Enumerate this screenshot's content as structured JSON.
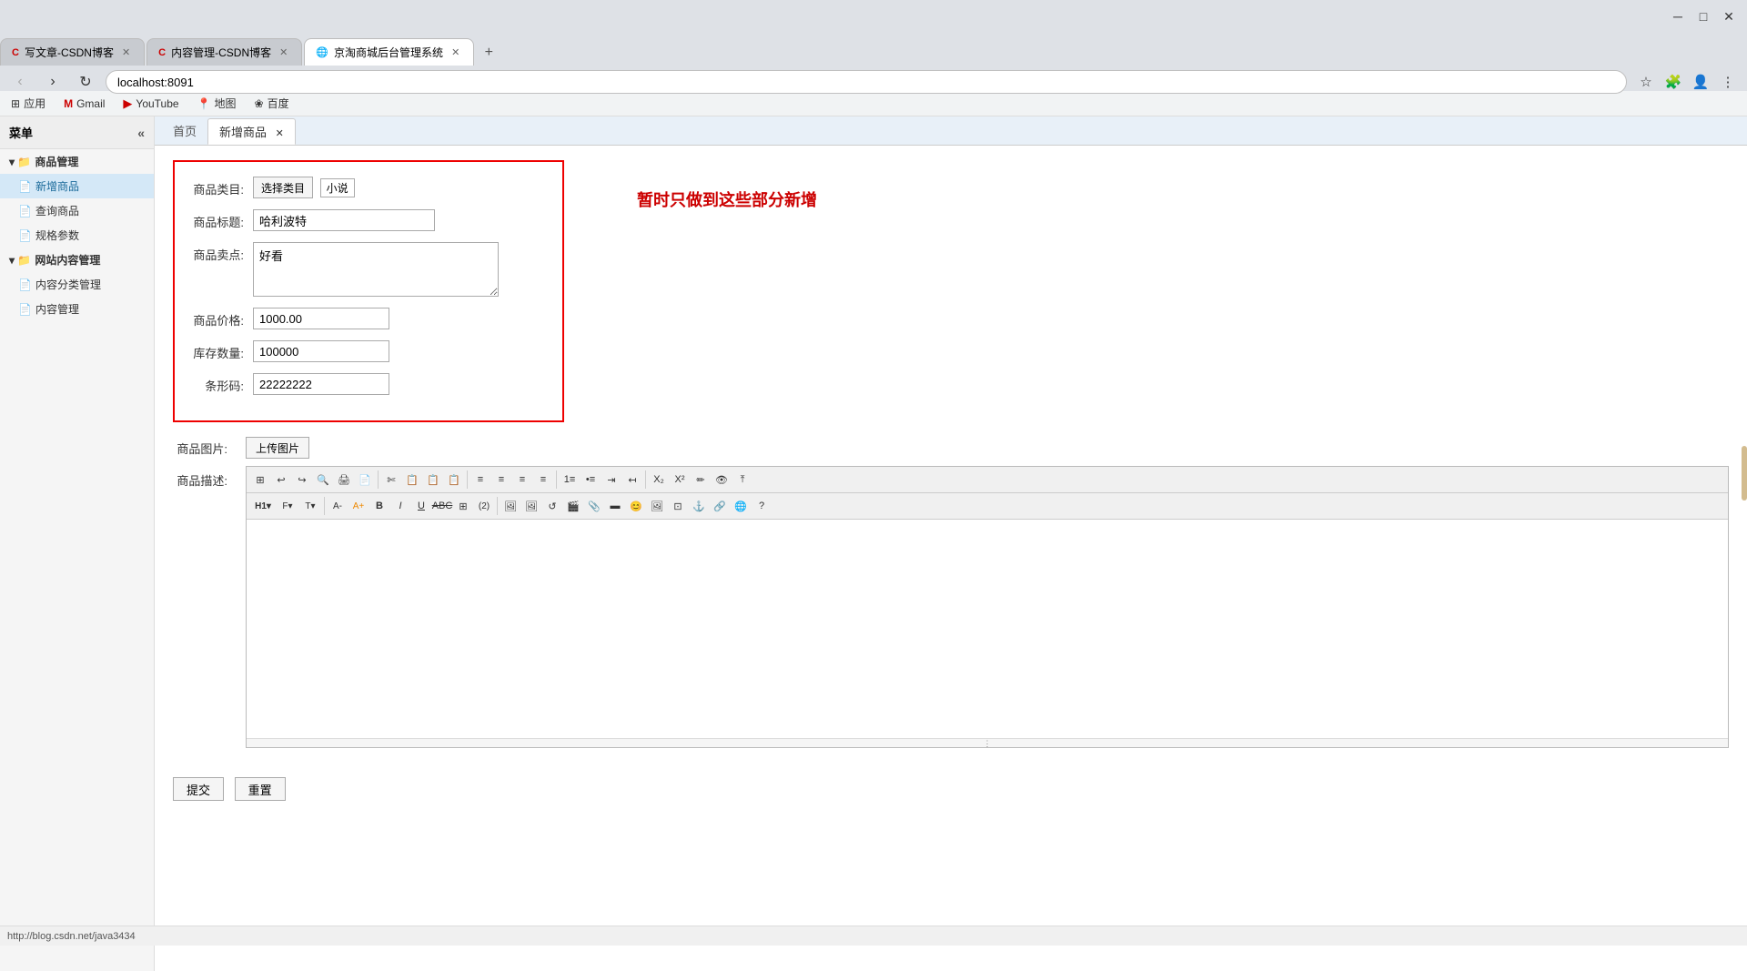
{
  "browser": {
    "tabs": [
      {
        "id": "tab1",
        "title": "写文章-CSDN博客",
        "active": false,
        "favicon": "C"
      },
      {
        "id": "tab2",
        "title": "内容管理-CSDN博客",
        "active": false,
        "favicon": "C"
      },
      {
        "id": "tab3",
        "title": "京淘商城后台管理系统",
        "active": true,
        "favicon": "🌐"
      }
    ],
    "address": "localhost:8091",
    "bookmarks": [
      {
        "label": "应用",
        "icon": "⊞"
      },
      {
        "label": "Gmail",
        "icon": "M"
      },
      {
        "label": "YouTube",
        "icon": "▶"
      },
      {
        "label": "地图",
        "icon": "📍"
      },
      {
        "label": "百度",
        "icon": "❀"
      }
    ]
  },
  "sidebar": {
    "title": "菜单",
    "categories": [
      {
        "label": "商品管理",
        "icon": "▾",
        "children": [
          {
            "label": "新增商品",
            "selected": true
          },
          {
            "label": "查询商品",
            "selected": false
          },
          {
            "label": "规格参数",
            "selected": false
          }
        ]
      },
      {
        "label": "网站内容管理",
        "icon": "▾",
        "children": [
          {
            "label": "内容分类管理",
            "selected": false
          },
          {
            "label": "内容管理",
            "selected": false
          }
        ]
      }
    ]
  },
  "page_tabs": [
    {
      "label": "首页",
      "active": false
    },
    {
      "label": "新增商品",
      "active": true,
      "closeable": true
    }
  ],
  "form": {
    "category_label": "商品类目:",
    "category_btn": "选择类目",
    "category_tag": "小说",
    "title_label": "商品标题:",
    "title_value": "哈利波特",
    "selling_label": "商品卖点:",
    "selling_value": "好看",
    "price_label": "商品价格:",
    "price_value": "1000.00",
    "stock_label": "库存数量:",
    "stock_value": "100000",
    "barcode_label": "条形码:",
    "barcode_value": "22222222",
    "image_label": "商品图片:",
    "image_btn": "上传图片",
    "desc_label": "商品描述:"
  },
  "notice_text": "暂时只做到这些部分新增",
  "editor": {
    "toolbar_row1": [
      "⊞",
      "↩",
      "↪",
      "🔍",
      "🖨",
      "📄",
      "✄",
      "📋",
      "📋",
      "📋",
      "⬛",
      "═",
      "≡",
      "≡",
      "≡",
      "≡",
      "⋮≡",
      "≡⋮",
      "⇥",
      "↤",
      "✖",
      "✖",
      "✏",
      "✏",
      "⤒"
    ],
    "toolbar_row2": [
      "H1",
      "F",
      "T",
      "A-",
      "A",
      "B",
      "I",
      "U",
      "ABC",
      "⊞",
      "(2)",
      "🖼",
      "🖼",
      "↺",
      "🎬",
      "📎",
      "▣",
      "😊",
      "🖼",
      "⊞",
      "⚓",
      "🔗",
      "🌐",
      "?"
    ]
  },
  "buttons": {
    "submit": "提交",
    "reset": "重置"
  },
  "status_bar": {
    "url_hint": "http://blog.csdn.net/java3434"
  }
}
